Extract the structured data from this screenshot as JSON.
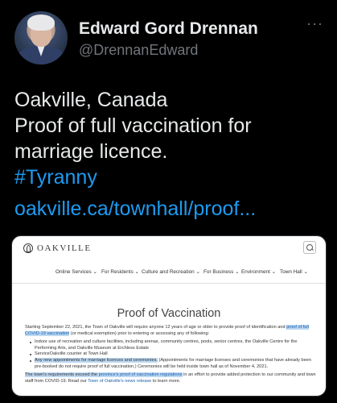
{
  "tweet": {
    "author_name": "Edward Gord Drennan",
    "author_handle": "@DrennanEdward",
    "more_icon": "···",
    "lines": [
      "Oakville, Canada",
      "Proof of full vaccination for",
      "marriage licence."
    ],
    "hashtag": "#Tyranny",
    "link": "oakville.ca/townhall/proof..."
  },
  "site": {
    "logo_text": "OAKVILLE",
    "nav": [
      "Online Services ⌄",
      "For Residents ⌄",
      "Culture and Recreation ⌄",
      "For Business ⌄",
      "Environment ⌄",
      "Town Hall ⌄"
    ],
    "page_title": "Proof of Vaccination",
    "intro_before": "Starting September 22, 2021, the Town of Oakville will require anyone 12 years of age or older to provide proof of identification and ",
    "intro_link": "proof of full COVID-19 vaccination",
    "intro_after": " (or medical exemption) prior to entering or accessing any of following:",
    "bullets": {
      "b1": "Indoor use of recreation and culture facilities, including arenas, community centres, pools, senior centres, the Oakville Centre for the Performing Arts, and Oakville Museum at Erchless Estate",
      "b2": "ServiceOakville counter at Town Hall",
      "b3_hl": "Any new appointments for marriage licences and ceremonies.",
      "b3_rest": " (Appointments for marriage licenses and ceremonies that have already been pre-booked do not require proof of full vaccination.) Ceremonies will be held inside town hall as of November 4, 2021."
    },
    "footer_hl1": "The town's requirements exceed the ",
    "footer_link1": "province's proof of vaccination regulations",
    "footer_mid": " in an effort to provide added protection to our community and town staff from COVID-19. Read our ",
    "footer_link2": "Town of Oakville's news release",
    "footer_end": " to learn more."
  }
}
